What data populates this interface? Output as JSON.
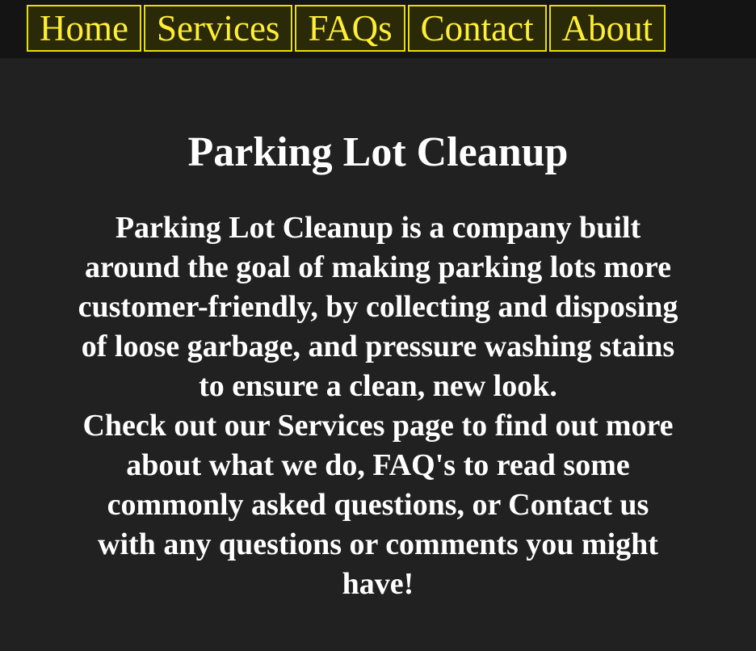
{
  "nav": {
    "items": [
      {
        "label": "Home"
      },
      {
        "label": "Services"
      },
      {
        "label": "FAQs"
      },
      {
        "label": "Contact"
      },
      {
        "label": "About"
      }
    ]
  },
  "main": {
    "title": "Parking Lot Cleanup",
    "paragraph1": "Parking Lot Cleanup is a company built around the goal of making parking lots more customer-friendly, by collecting and disposing of loose garbage, and pressure washing stains to ensure a clean, new look.",
    "paragraph2": "Check out our Services page to find out more about what we do, FAQ's to read some commonly asked questions, or Contact us with any questions or comments you might have!"
  },
  "colors": {
    "background": "#212121",
    "navbar": "#141414",
    "nav_text": "#ffee33",
    "nav_border": "#e8e000",
    "body_text": "#ffffff"
  }
}
